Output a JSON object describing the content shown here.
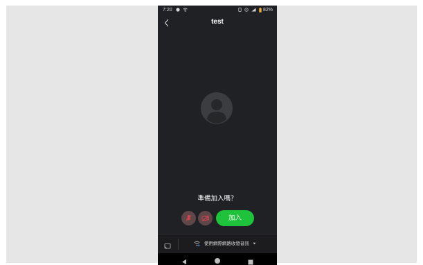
{
  "status_bar": {
    "time": "7:20",
    "battery": "82%",
    "left_icons": [
      "notification-icon",
      "wifi-icon"
    ],
    "right_icons": [
      "vibrate-icon",
      "alarm-icon",
      "signal-icon",
      "battery-icon"
    ]
  },
  "header": {
    "title": "test",
    "back_icon": "chevron-left-icon"
  },
  "main": {
    "prompt": "準備加入嗎？",
    "avatar_icon": "person-silhouette-icon"
  },
  "controls": {
    "mic_icon": "microphone-off-icon",
    "camera_icon": "camera-off-icon",
    "join_label": "加入",
    "join_color": "#1fc23b",
    "muted_button_color": "#5e4649"
  },
  "bottom_bar": {
    "cast_icon": "cast-icon",
    "audio_option_label": "使用網際網路收發音訊",
    "audio_icon": "wifi-icon",
    "dropdown_icon": "caret-down-icon"
  },
  "nav_bar": {
    "icons": [
      "back-triangle-icon",
      "home-circle-icon",
      "recent-square-icon"
    ]
  }
}
